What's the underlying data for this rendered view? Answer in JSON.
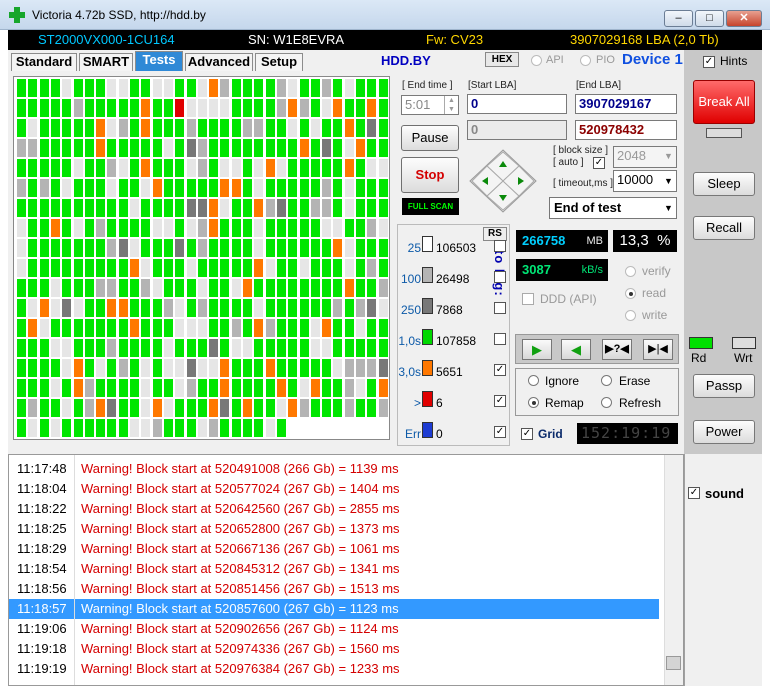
{
  "window": {
    "title": "Victoria 4.72b SSD, http://hdd.by",
    "min": "–",
    "max": "□",
    "close": "✕"
  },
  "info": {
    "model": "ST2000VX000-1CU164",
    "sn": "SN: W1E8EVRA",
    "fw": "Fw: CV23",
    "lba": "3907029168 LBA (2,0 Tb)"
  },
  "tabs": [
    "Standard",
    "SMART",
    "Tests",
    "Advanced",
    "Setup"
  ],
  "header": {
    "hddby": "HDD.BY",
    "hex": "HEX",
    "api": "API",
    "pio": "PIO",
    "device": "Device 1",
    "hints": "Hints"
  },
  "controls": {
    "end_time_label": "[ End time ]",
    "end_time": "5:01",
    "start_lba_label": "[Start LBA]",
    "start_lba": "0",
    "start_lba2": "0",
    "end_lba_label": "[End LBA]",
    "end_lba": "3907029167",
    "end_lba2": "520978432",
    "pause": "Pause",
    "stop": "Stop",
    "full_scan": "FULL SCAN",
    "block_size_label": "[ block size ]",
    "auto_label": "[ auto ]",
    "block_size": "2048",
    "timeout_label": "[ timeout,ms ]",
    "timeout": "10000",
    "end_of_test": "End of test"
  },
  "stats": {
    "rs": "RS",
    "to_log": "to log:",
    "rows": [
      {
        "label": "25",
        "value": "106503",
        "color": "#ffffff",
        "logged": false
      },
      {
        "label": "100",
        "value": "26498",
        "color": "#b4b4b4",
        "logged": false
      },
      {
        "label": "250",
        "value": "7868",
        "color": "#787878",
        "logged": false
      },
      {
        "label": "1,0s",
        "value": "107858",
        "color": "#00d800",
        "logged": false
      },
      {
        "label": "3,0s",
        "value": "5651",
        "color": "#ff7800",
        "logged": true
      },
      {
        "label": ">",
        "value": "6",
        "color": "#e00000",
        "logged": true
      },
      {
        "label": "Err",
        "value": "0",
        "color": "#1e3cd2",
        "logged": true
      }
    ]
  },
  "progress": {
    "mb": "266758",
    "mb_unit": "MB",
    "percent": "13,3",
    "percent_unit": "%",
    "speed": "3087",
    "speed_unit": "kB/s"
  },
  "options": {
    "ddd": "DDD (API)",
    "verify": "verify",
    "read": "read",
    "write": "write"
  },
  "modes": {
    "ignore": "Ignore",
    "erase": "Erase",
    "remap": "Remap",
    "refresh": "Refresh",
    "selected": "Remap"
  },
  "grid_label": "Grid",
  "timer": "152:19:19",
  "right": {
    "break_all": "Break All",
    "sleep": "Sleep",
    "recall": "Recall",
    "rd": "Rd",
    "wrt": "Wrt",
    "passp": "Passp",
    "power": "Power",
    "sound": "sound"
  },
  "log": [
    {
      "time": "11:17:48",
      "msg": "Warning! Block start at 520491008 (266 Gb)  = 1139 ms"
    },
    {
      "time": "11:18:04",
      "msg": "Warning! Block start at 520577024 (267 Gb)  = 1404 ms"
    },
    {
      "time": "11:18:22",
      "msg": "Warning! Block start at 520642560 (267 Gb)  = 2855 ms"
    },
    {
      "time": "11:18:25",
      "msg": "Warning! Block start at 520652800 (267 Gb)  = 1373 ms"
    },
    {
      "time": "11:18:29",
      "msg": "Warning! Block start at 520667136 (267 Gb)  = 1061 ms"
    },
    {
      "time": "11:18:54",
      "msg": "Warning! Block start at 520845312 (267 Gb)  = 1341 ms"
    },
    {
      "time": "11:18:56",
      "msg": "Warning! Block start at 520851456 (267 Gb)  = 1513 ms"
    },
    {
      "time": "11:18:57",
      "msg": "Warning! Block start at 520857600 (267 Gb)  = 1123 ms",
      "selected": true
    },
    {
      "time": "11:19:06",
      "msg": "Warning! Block start at 520902656 (267 Gb)  = 1124 ms"
    },
    {
      "time": "11:19:18",
      "msg": "Warning! Block start at 520974336 (267 Gb)  = 1560 ms"
    },
    {
      "time": "11:19:19",
      "msg": "Warning! Block start at 520976384 (267 Gb)  = 1233 ms"
    }
  ],
  "colors": {
    "green": "#00e600",
    "orange": "#ff7800",
    "red": "#e00000",
    "light": "#e6e6e6",
    "mid": "#b4b4b4",
    "dark": "#787878"
  }
}
